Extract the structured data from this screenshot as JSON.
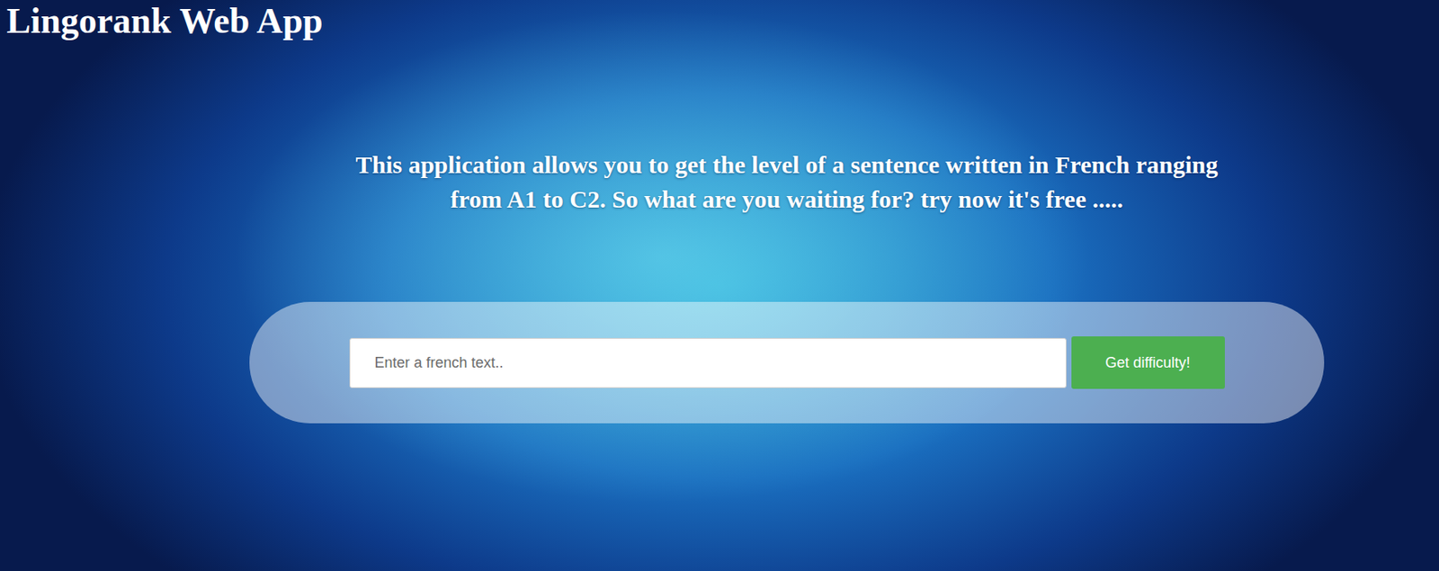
{
  "app": {
    "title": "Lingorank Web App"
  },
  "intro": {
    "text": "This application allows you to get the level of a sentence written in French ranging from A1 to C2. So what are you waiting for? try now it's free ....."
  },
  "search": {
    "placeholder": "Enter a french text..",
    "value": ""
  },
  "buttons": [
    "Get difficulty!"
  ]
}
